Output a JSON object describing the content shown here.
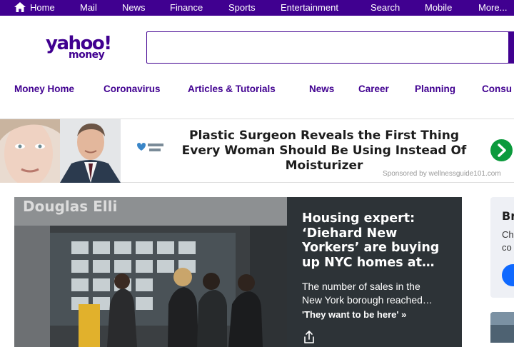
{
  "topnav": {
    "items": [
      "Home",
      "Mail",
      "News",
      "Finance",
      "Sports",
      "Entertainment",
      "Search",
      "Mobile",
      "More..."
    ]
  },
  "logo": {
    "word": "yahoo!",
    "sub": "money"
  },
  "search": {
    "placeholder": ""
  },
  "secnav": {
    "items": [
      "Money Home",
      "Coronavirus",
      "Articles & Tutorials",
      "News",
      "Career",
      "Planning",
      "Consu"
    ]
  },
  "ad": {
    "brand": "Wellness Guide 101",
    "headline": "Plastic Surgeon Reveals the First Thing Every Woman Should Be Using Instead Of Moisturizer",
    "sponsor": "Sponsored by wellnessguide101.com"
  },
  "hero": {
    "title": "Housing expert: ‘Diehard New Yorkers’ are buying up NYC homes at…",
    "summary_lines": [
      "The number of sales in the",
      "New York borough reached…"
    ],
    "link": "'They want to be here' »",
    "photo_sign": "Douglas Elli"
  },
  "sidebar": {
    "title": "Br",
    "body_lines": [
      "Ch",
      "co"
    ]
  },
  "icons": {
    "home": "home-icon",
    "share": "share-icon",
    "ad_arrow": "chevron-right-icon"
  },
  "colors": {
    "brand": "#400090",
    "ad_arrow": "#0b9a3c",
    "hero_panel": "#2d3337",
    "side_button": "#0f69ff"
  }
}
